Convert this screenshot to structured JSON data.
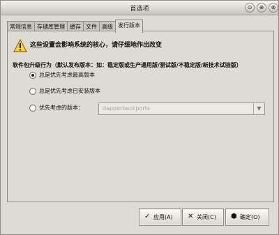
{
  "window": {
    "title": "首选项",
    "controls": [
      "⊙",
      "⊕",
      "⊗"
    ]
  },
  "tabs": [
    {
      "label": "常规信息"
    },
    {
      "label": "存储库管理"
    },
    {
      "label": "缓存"
    },
    {
      "label": "文件"
    },
    {
      "label": "高级"
    },
    {
      "label": "发行版本"
    }
  ],
  "content": {
    "warning": "这些设置会影响系统的核心，请仔细地作出改变",
    "group_title": "软件包升级行为（默认发布版本：如：稳定版或生产通用版/测试版/不稳定版/新技术试验版）",
    "options": [
      {
        "label": "总是优先考虑最高版本"
      },
      {
        "label": "总是优先考虑已安装版本"
      },
      {
        "label": "优先考虑的版本："
      }
    ],
    "release_dropdown": "dapperbackports"
  },
  "buttons": [
    {
      "label": "应用(A)",
      "icon": "check-icon"
    },
    {
      "label": "关闭(C)",
      "icon": "close-icon"
    },
    {
      "label": "确定(O)",
      "icon": "ok-icon"
    }
  ]
}
